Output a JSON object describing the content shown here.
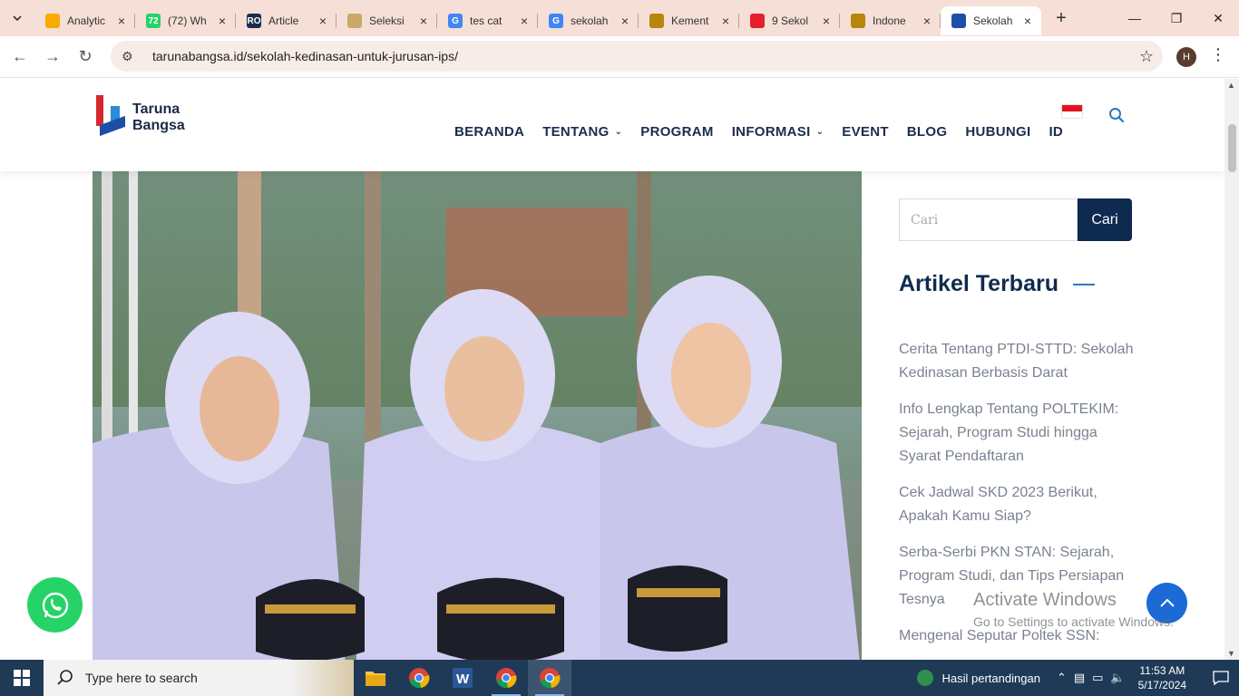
{
  "browser": {
    "tabs": [
      {
        "title": "Analytic",
        "fav_color": "#f9ab00"
      },
      {
        "title": "(72) Wh",
        "fav_color": "#25d366",
        "fav_text": "72"
      },
      {
        "title": "Article",
        "fav_color": "#1a2b4c",
        "fav_text": "RO"
      },
      {
        "title": "Seleksi",
        "fav_color": "#c9a86a"
      },
      {
        "title": "tes cat",
        "fav_color": "#4285f4",
        "fav_text": "G"
      },
      {
        "title": "sekolah",
        "fav_color": "#4285f4",
        "fav_text": "G"
      },
      {
        "title": "Kement",
        "fav_color": "#b8860b"
      },
      {
        "title": "9 Sekol",
        "fav_color": "#e3202b"
      },
      {
        "title": "Indone",
        "fav_color": "#b8860b"
      },
      {
        "title": "Sekolah",
        "fav_color": "#1d4fa8",
        "active": true
      }
    ],
    "new_tab": "+",
    "url": "tarunabangsa.id/sekolah-kedinasan-untuk-jurusan-ips/",
    "profile_initial": "H"
  },
  "site": {
    "logo_line1": "Taruna",
    "logo_line2": "Bangsa",
    "nav": [
      {
        "label": "BERANDA"
      },
      {
        "label": "TENTANG",
        "dropdown": true
      },
      {
        "label": "PROGRAM"
      },
      {
        "label": "INFORMASI",
        "dropdown": true
      },
      {
        "label": "EVENT"
      },
      {
        "label": "BLOG"
      },
      {
        "label": "HUBUNGI"
      },
      {
        "label": "ID"
      }
    ]
  },
  "sidebar": {
    "search_placeholder": "Cari",
    "search_button": "Cari",
    "widget_title": "Artikel Terbaru",
    "posts": [
      "Cerita Tentang PTDI-STTD: Sekolah Kedinasan Berbasis Darat",
      "Info Lengkap Tentang POLTEKIM: Sejarah, Program Studi hingga Syarat Pendaftaran",
      "Cek Jadwal SKD 2023 Berikut, Apakah Kamu Siap?",
      "Serba-Serbi PKN STAN: Sejarah, Program Studi, dan Tips Persiapan Tesnya",
      "Mengenal Seputar Poltek SSN:"
    ]
  },
  "watermark": {
    "line1": "Activate Windows",
    "line2": "Go to Settings to activate Windows."
  },
  "taskbar": {
    "search_text": "Type here to search",
    "news_text": "Hasil pertandingan",
    "time": "11:53 AM",
    "date": "5/17/2024"
  },
  "colors": {
    "brand_navy": "#0e2a4f",
    "whatsapp": "#25d366",
    "scroll_top": "#1b6ad6"
  }
}
